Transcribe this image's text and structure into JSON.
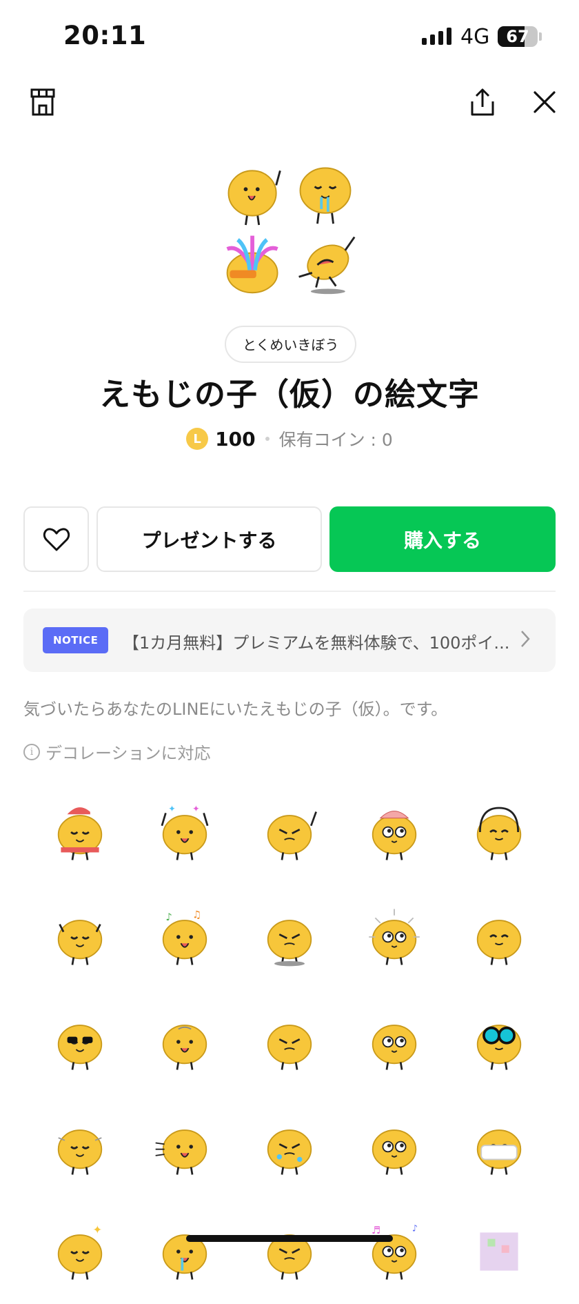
{
  "status_bar": {
    "time": "20:11",
    "network": "4G",
    "battery": "67",
    "battery_level": 0.67
  },
  "header": {
    "icons": [
      "shop-icon",
      "share-icon",
      "close-icon"
    ]
  },
  "product": {
    "author": "とくめいきぼう",
    "title": "えもじの子（仮）の絵文字",
    "coin_symbol": "L",
    "price": "100",
    "owned_coins": "保有コイン : 0"
  },
  "actions": {
    "gift_label": "プレゼントする",
    "buy_label": "購入する"
  },
  "notice": {
    "badge": "NOTICE",
    "text": "【1カ月無料】プレミアムを無料体験で、100ポイ..."
  },
  "description": "気づいたらあなたのLINEにいたえもじの子（仮）。です。",
  "decoration": "デコレーションに対応",
  "colors": {
    "buy": "#06c755",
    "notice_badge": "#5b6cf6",
    "emoji_yellow": "#f7c63a"
  }
}
